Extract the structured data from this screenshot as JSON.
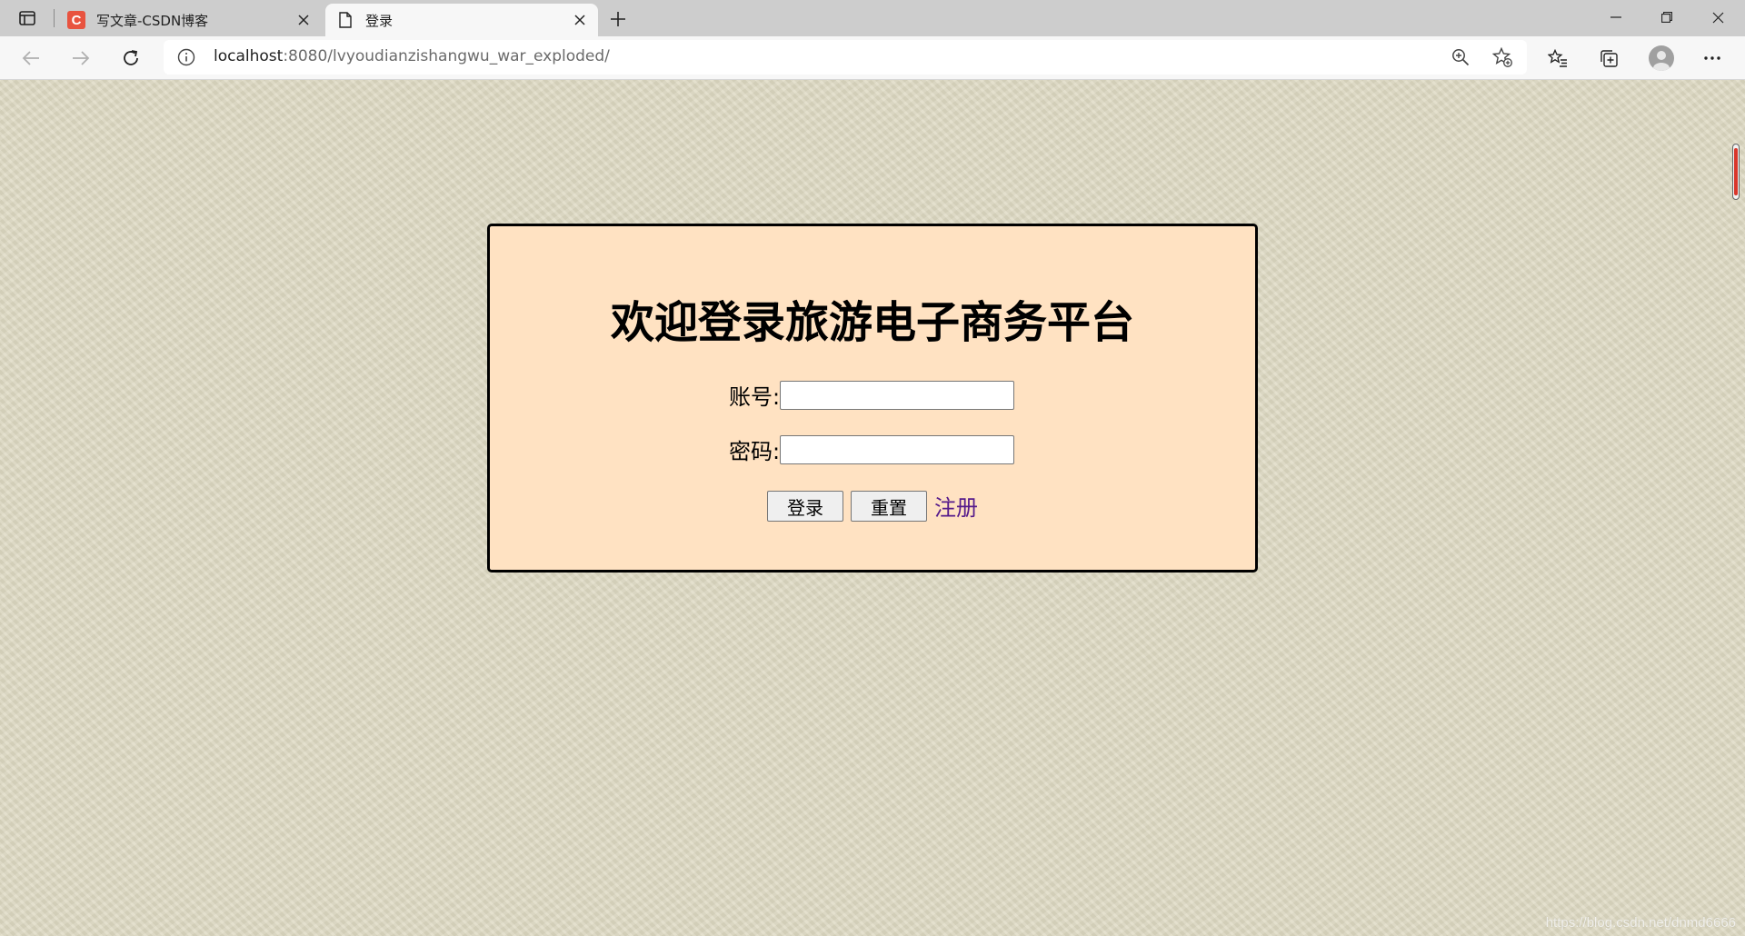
{
  "browser": {
    "tabs": [
      {
        "title": "写文章-CSDN博客",
        "favicon_letter": "C"
      },
      {
        "title": "登录"
      }
    ],
    "address": {
      "host": "localhost",
      "rest": ":8080/lvyoudianzishangwu_war_exploded/"
    },
    "icons": {
      "tab_actions": "tab-actions-icon",
      "new_tab": "plus-icon",
      "back": "back-arrow-icon",
      "forward": "forward-arrow-icon",
      "refresh": "refresh-icon",
      "info": "info-icon",
      "zoom": "zoom-icon",
      "add_favorite": "star-add-icon",
      "favorites": "favorites-icon",
      "collections": "collections-icon",
      "profile": "profile-avatar-icon",
      "more": "more-icon",
      "minimize": "minimize-icon",
      "restore": "restore-icon",
      "close": "close-icon"
    }
  },
  "login": {
    "title": "欢迎登录旅游电子商务平台",
    "account_label": "账号:",
    "account_value": "",
    "password_label": "密码:",
    "password_value": "",
    "submit_label": "登录",
    "reset_label": "重置",
    "register_label": "注册"
  },
  "watermark": "https://blog.csdn.net/dnmd6666",
  "colors": {
    "box_background": "#ffe2c2",
    "box_border": "#000000",
    "link": "#551a8b",
    "page_background": "#dedac3"
  }
}
